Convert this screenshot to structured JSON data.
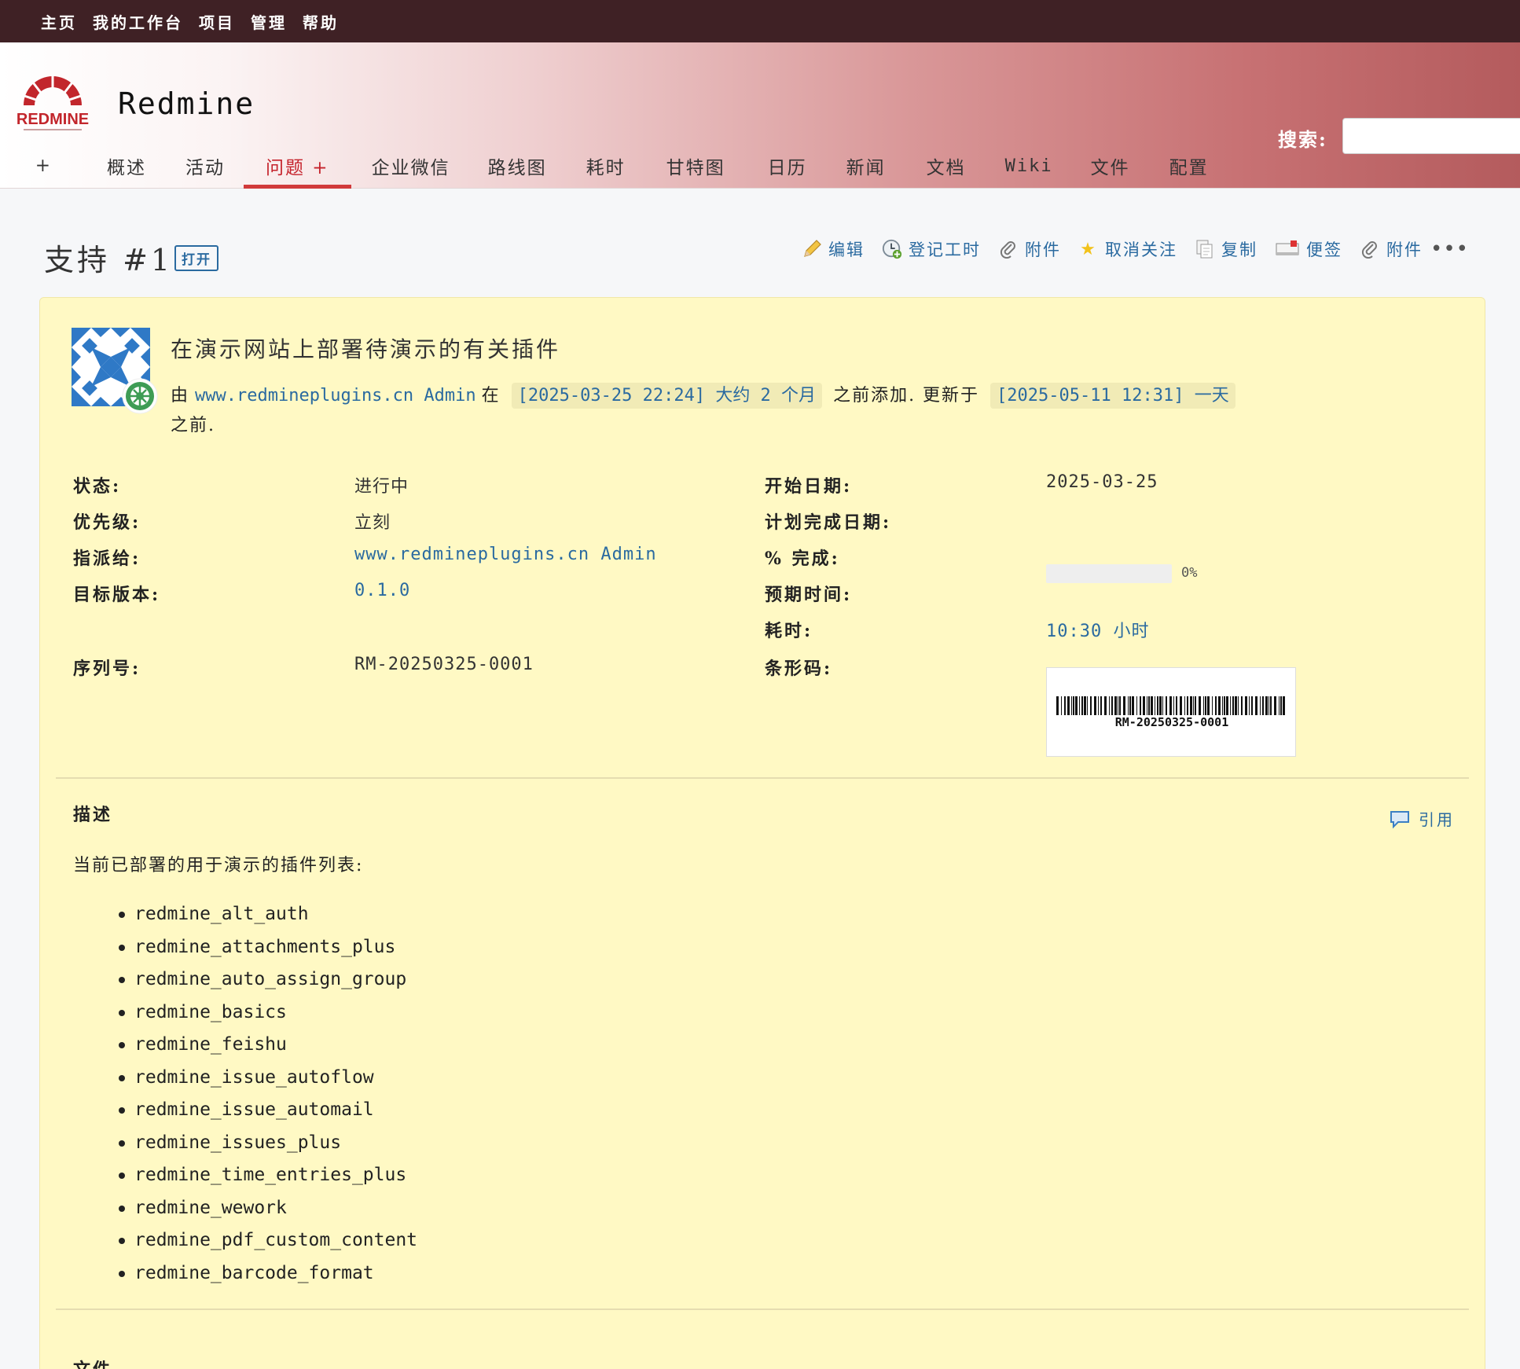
{
  "top_menu": {
    "items": [
      "主页",
      "我的工作台",
      "项目",
      "管理",
      "帮助"
    ]
  },
  "header": {
    "project_title": "Redmine",
    "logo_text": "REDMINE",
    "search_label": "搜索:",
    "search_placeholder": ""
  },
  "main_menu": {
    "new_label": "+",
    "tabs": [
      {
        "label": "概述"
      },
      {
        "label": "活动"
      },
      {
        "label": "问题 +"
      },
      {
        "label": "企业微信"
      },
      {
        "label": "路线图"
      },
      {
        "label": "耗时"
      },
      {
        "label": "甘特图"
      },
      {
        "label": "日历"
      },
      {
        "label": "新闻"
      },
      {
        "label": "文档"
      },
      {
        "label": "Wiki"
      },
      {
        "label": "文件"
      },
      {
        "label": "配置"
      }
    ],
    "selected": "问题 +"
  },
  "issue": {
    "heading": "支持 #1",
    "status_tag": "打开",
    "actions": [
      {
        "label": "编辑",
        "icon": "pencil-icon"
      },
      {
        "label": "登记工时",
        "icon": "clock-add-icon"
      },
      {
        "label": "附件",
        "icon": "paperclip-icon"
      },
      {
        "label": "取消关注",
        "icon": "star-icon"
      },
      {
        "label": "复制",
        "icon": "copy-icon"
      },
      {
        "label": "便签",
        "icon": "sticky-note-icon"
      },
      {
        "label": "附件",
        "icon": "paperclip-icon"
      }
    ],
    "more": "•••",
    "subject": "在演示网站上部署待演示的有关插件",
    "author_prefix": "由",
    "author": "www.redmineplugins.cn Admin",
    "author_mid": "在",
    "created": "[2025-03-25 22:24] 大约 2 个月",
    "created_suffix": "之前添加. 更新于",
    "updated": "[2025-05-11 12:31] 一天",
    "updated_suffix": "之前.",
    "attributes": {
      "status": {
        "label": "状态:",
        "value": "进行中"
      },
      "priority": {
        "label": "优先级:",
        "value": "立刻"
      },
      "assigned_to": {
        "label": "指派给:",
        "value": "www.redmineplugins.cn Admin"
      },
      "target_version": {
        "label": "目标版本:",
        "value": "0.1.0"
      },
      "serial_no": {
        "label": "序列号:",
        "value": "RM-20250325-0001"
      },
      "start_date": {
        "label": "开始日期:",
        "value": "2025-03-25"
      },
      "due_date": {
        "label": "计划完成日期:",
        "value": ""
      },
      "done_ratio": {
        "label": "% 完成:",
        "value": "0%",
        "percent": 0
      },
      "estimated": {
        "label": "预期时间:",
        "value": ""
      },
      "spent": {
        "label": "耗时:",
        "value": "10:30 小时"
      },
      "barcode": {
        "label": "条形码:",
        "value": "RM-20250325-0001"
      }
    },
    "description": {
      "title": "描述",
      "quote": "引用",
      "intro": "当前已部署的用于演示的插件列表:",
      "plugins": [
        "redmine_alt_auth",
        "redmine_attachments_plus",
        "redmine_auto_assign_group",
        "redmine_basics",
        "redmine_feishu",
        "redmine_issue_autoflow",
        "redmine_issue_automail",
        "redmine_issues_plus",
        "redmine_time_entries_plus",
        "redmine_wework",
        "redmine_pdf_custom_content",
        "redmine_barcode_format"
      ]
    },
    "files_title": "文件"
  },
  "colors": {
    "top_bar": "#3f2125",
    "accent_red": "#c5232c",
    "link": "#2a6aa0",
    "issue_bg": "#fff9c4"
  }
}
